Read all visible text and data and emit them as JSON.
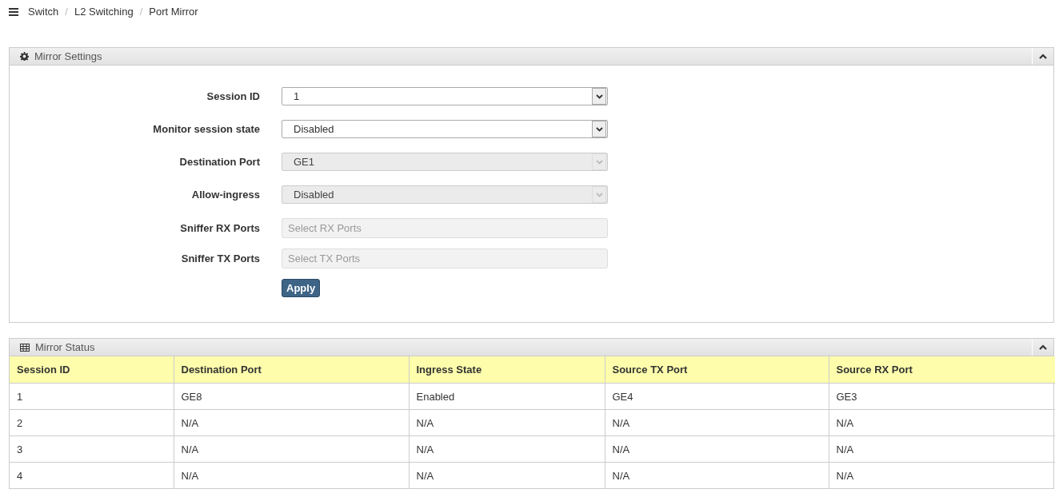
{
  "breadcrumb": {
    "items": [
      "Switch",
      "L2 Switching",
      "Port Mirror"
    ],
    "separators": [
      "/",
      "/"
    ]
  },
  "settings": {
    "title": "Mirror Settings",
    "fields": [
      {
        "label": "Session ID",
        "kind": "select",
        "value": "1",
        "disabled": false
      },
      {
        "label": "Monitor session state",
        "kind": "select",
        "value": "Disabled",
        "disabled": false
      },
      {
        "label": "Destination Port",
        "kind": "select",
        "value": "GE1",
        "disabled": true
      },
      {
        "label": "Allow-ingress",
        "kind": "select",
        "value": "Disabled",
        "disabled": true
      },
      {
        "label": "Sniffer RX Ports",
        "kind": "multiselect",
        "placeholder": "Select RX Ports",
        "disabled": true
      },
      {
        "label": "Sniffer TX Ports",
        "kind": "multiselect",
        "placeholder": "Select TX Ports",
        "disabled": true
      }
    ],
    "apply": "Apply"
  },
  "status": {
    "title": "Mirror Status",
    "columns": [
      "Session ID",
      "Destination Port",
      "Ingress State",
      "Source TX Port",
      "Source RX Port"
    ],
    "rows": [
      [
        "1",
        "GE8",
        "Enabled",
        "GE4",
        "GE3"
      ],
      [
        "2",
        "N/A",
        "N/A",
        "N/A",
        "N/A"
      ],
      [
        "3",
        "N/A",
        "N/A",
        "N/A",
        "N/A"
      ],
      [
        "4",
        "N/A",
        "N/A",
        "N/A",
        "N/A"
      ]
    ]
  }
}
